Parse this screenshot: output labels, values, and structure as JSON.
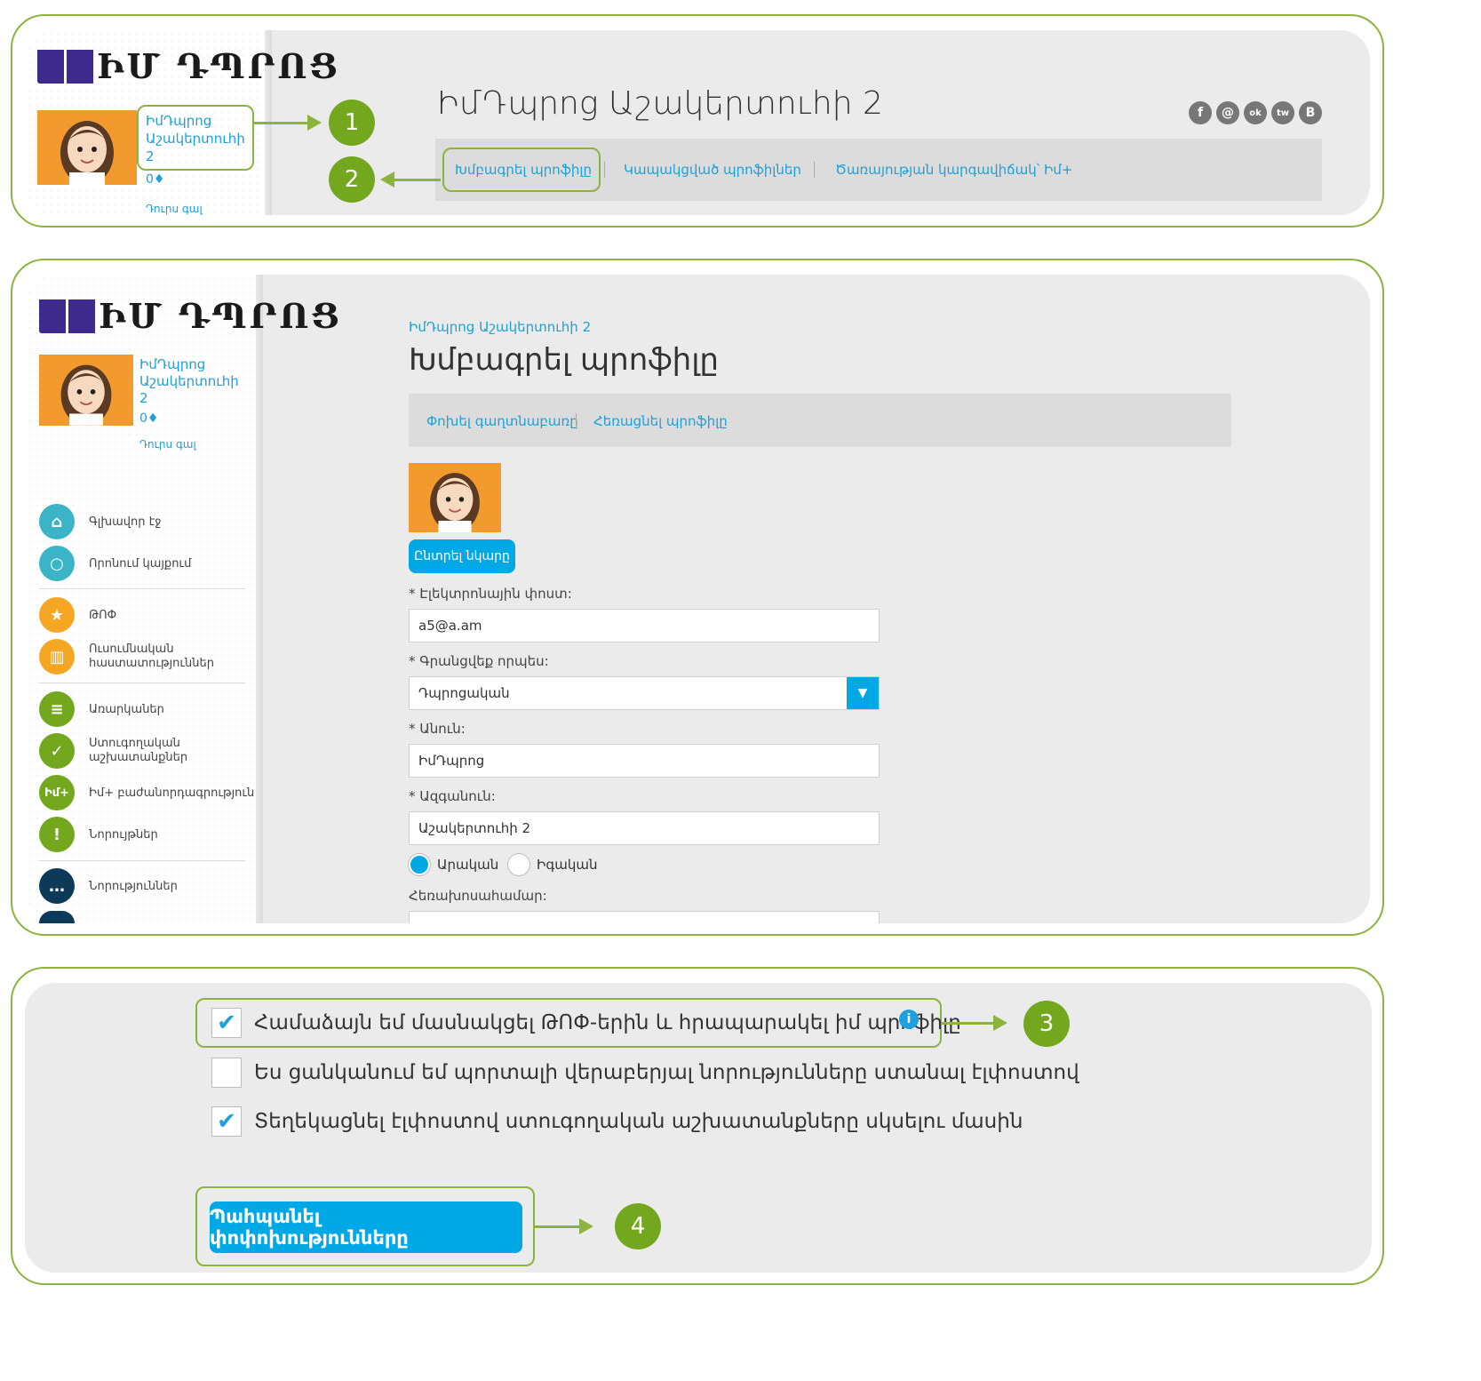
{
  "logo_text": "ԻՄ ԴՊՐՈՑ",
  "user": {
    "name_line1": "ԻմԴպրոց",
    "name_line2": "Աշակերտուհի",
    "name_line3": "2",
    "points": "0♦",
    "logout": "Դուրս գալ"
  },
  "callouts": {
    "n1": "1",
    "n2": "2",
    "n3": "3",
    "n4": "4"
  },
  "panel1": {
    "profile_title": "ԻմԴպրոց Աշակերտուհի 2",
    "nav": {
      "edit_profile": "Խմբագրել պրոֆիլը",
      "linked_profiles": "Կապակցված պրոֆիլներ",
      "service_plan": "Ծառայության կարգավիճակ՝ Իմ+"
    },
    "social": [
      "f",
      "@",
      "ok",
      "tw",
      "B"
    ]
  },
  "panel2": {
    "breadcrumb": "ԻմԴպրոց Աշակերտուհի 2",
    "page_title": "Խմբագրել պրոֆիլը",
    "subnav": {
      "change_password": "Փոխել գաղտնաբառը",
      "delete_profile": "Հեռացնել պրոֆիլը"
    },
    "choose_image": "Ընտրել նկարը",
    "email": {
      "label": "* Էլեկտրոնային փոստ:",
      "value": "a5@a.am"
    },
    "register_as": {
      "label": "* Գրանցվեք որպես:",
      "value": "Դպրոցական"
    },
    "first_name": {
      "label": "* Անուն:",
      "value": "ԻմԴպրոց"
    },
    "last_name": {
      "label": "* Ազգանուն:",
      "value": "Աշակերտուհի 2"
    },
    "gender": {
      "male": "Արական",
      "female": "Իգական",
      "selected": "male"
    },
    "phone": {
      "label": "Հեռախոսահամար:"
    },
    "menu": [
      {
        "label": "Գլխավոր էջ",
        "icon": "home-icon",
        "color": "#3cb4c8"
      },
      {
        "label": "Որոնում կայքում",
        "icon": "search-icon",
        "color": "#3cb4c8"
      },
      {
        "label": "ԹՈՓ",
        "icon": "star-icon",
        "color": "#f5a623"
      },
      {
        "label": "Ուսումնական հաստատություններ",
        "icon": "institution-icon",
        "color": "#f5a623"
      },
      {
        "label": "Առարկաներ",
        "icon": "subjects-icon",
        "color": "#73a71e"
      },
      {
        "label": "Ստուգողական աշխատանքներ",
        "icon": "check-icon",
        "color": "#73a71e"
      },
      {
        "label": "Իմ+ բաժանորդագրություն",
        "icon": "im-plus-icon",
        "color": "#73a71e"
      },
      {
        "label": "Նորույթներ",
        "icon": "exclamation-icon",
        "color": "#73a71e"
      },
      {
        "label": "Նորություններ",
        "icon": "chat-icon",
        "color": "#0e3a5a"
      }
    ]
  },
  "panel3": {
    "agree_top": "Համաձայն եմ մասնակցել ԹՈՓ-երին և հրապարակել իմ պրոֆիլը",
    "newsletter": "Ես ցանկանում եմ պորտալի վերաբերյալ նորությունները ստանալ էլփոստով",
    "notify_tests": "Տեղեկացնել էլփոստով ստուգողական աշխատանքները սկսելու մասին",
    "save_button": "Պահպանել փոփոխությունները",
    "checked": {
      "agree_top": true,
      "newsletter": false,
      "notify_tests": true
    }
  }
}
